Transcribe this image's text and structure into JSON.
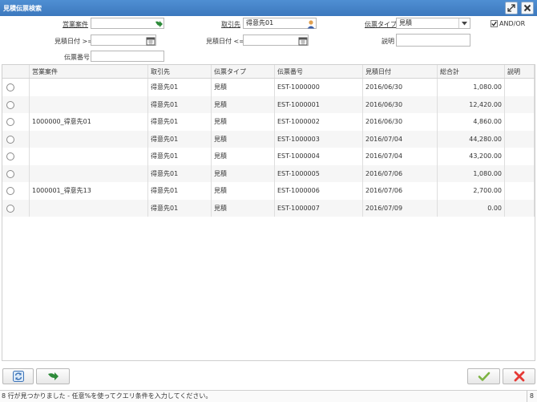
{
  "window": {
    "title": "見積伝票検索"
  },
  "form": {
    "deal_label": "営業案件",
    "deal_value": "",
    "client_label": "取引先",
    "client_value": "得意先01",
    "slip_type_label": "伝票タイプ",
    "slip_type_value": "見積",
    "andor_label": "AND/OR",
    "andor_checked": true,
    "date_from_label": "見積日付 >=",
    "date_from_value": "",
    "date_to_label": "見積日付 <=",
    "date_to_value": "",
    "description_label": "説明",
    "description_value": "",
    "slip_no_label": "伝票番号",
    "slip_no_value": ""
  },
  "table": {
    "columns": [
      "営業案件",
      "取引先",
      "伝票タイプ",
      "伝票番号",
      "見積日付",
      "総合計",
      "説明"
    ],
    "rows": [
      {
        "deal": "",
        "client": "得意先01",
        "type": "見積",
        "no": "EST-1000000",
        "date": "2016/06/30",
        "total": "1,080.00",
        "desc": ""
      },
      {
        "deal": "",
        "client": "得意先01",
        "type": "見積",
        "no": "EST-1000001",
        "date": "2016/06/30",
        "total": "12,420.00",
        "desc": ""
      },
      {
        "deal": "1000000_得意先01",
        "client": "得意先01",
        "type": "見積",
        "no": "EST-1000002",
        "date": "2016/06/30",
        "total": "4,860.00",
        "desc": ""
      },
      {
        "deal": "",
        "client": "得意先01",
        "type": "見積",
        "no": "EST-1000003",
        "date": "2016/07/04",
        "total": "44,280.00",
        "desc": ""
      },
      {
        "deal": "",
        "client": "得意先01",
        "type": "見積",
        "no": "EST-1000004",
        "date": "2016/07/04",
        "total": "43,200.00",
        "desc": ""
      },
      {
        "deal": "",
        "client": "得意先01",
        "type": "見積",
        "no": "EST-1000005",
        "date": "2016/07/06",
        "total": "1,080.00",
        "desc": ""
      },
      {
        "deal": "1000001_得意先13",
        "client": "得意先01",
        "type": "見積",
        "no": "EST-1000006",
        "date": "2016/07/06",
        "total": "2,700.00",
        "desc": ""
      },
      {
        "deal": "",
        "client": "得意先01",
        "type": "見積",
        "no": "EST-1000007",
        "date": "2016/07/09",
        "total": "0.00",
        "desc": ""
      }
    ]
  },
  "status": {
    "message": "8 行が見つかりました - 任意%を使ってクエリ条件を入力してください。",
    "count": "8"
  },
  "icons": {
    "maximize": "maximize-icon",
    "close": "close-icon",
    "refresh": "refresh-icon",
    "zoom": "zoom-arrow-icon",
    "ok": "check-icon",
    "cancel": "x-icon",
    "user": "user-icon",
    "calendar": "calendar-icon"
  },
  "colors": {
    "title_bg": "#3c78bd",
    "ok": "#7cb342",
    "cancel": "#e53935"
  }
}
